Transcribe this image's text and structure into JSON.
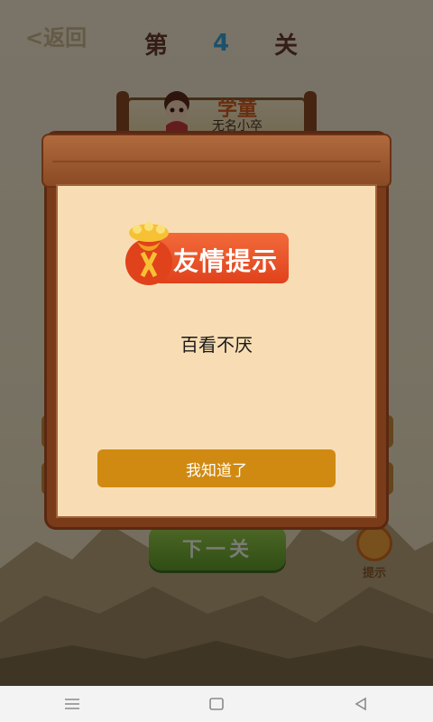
{
  "game": {
    "back_label": "<返回",
    "level": {
      "prefix": "第",
      "number": "4",
      "suffix": "关"
    },
    "banner": {
      "title": "学童",
      "player_name": "无名小卒"
    },
    "next_button_label": "下一关",
    "hint_button_label": "提示"
  },
  "dialog": {
    "badge_label": "友情提示",
    "message": "百看不厌",
    "ok_button_label": "我知道了"
  },
  "colors": {
    "overlay": "#000000",
    "dialog_bg": "#f8ddb4",
    "frame": "#7a3b1a",
    "badge": "#e85a2a",
    "ok_button": "#d08a12"
  },
  "navbar": {
    "icons": [
      "menu-icon",
      "home-icon",
      "back-icon"
    ]
  }
}
